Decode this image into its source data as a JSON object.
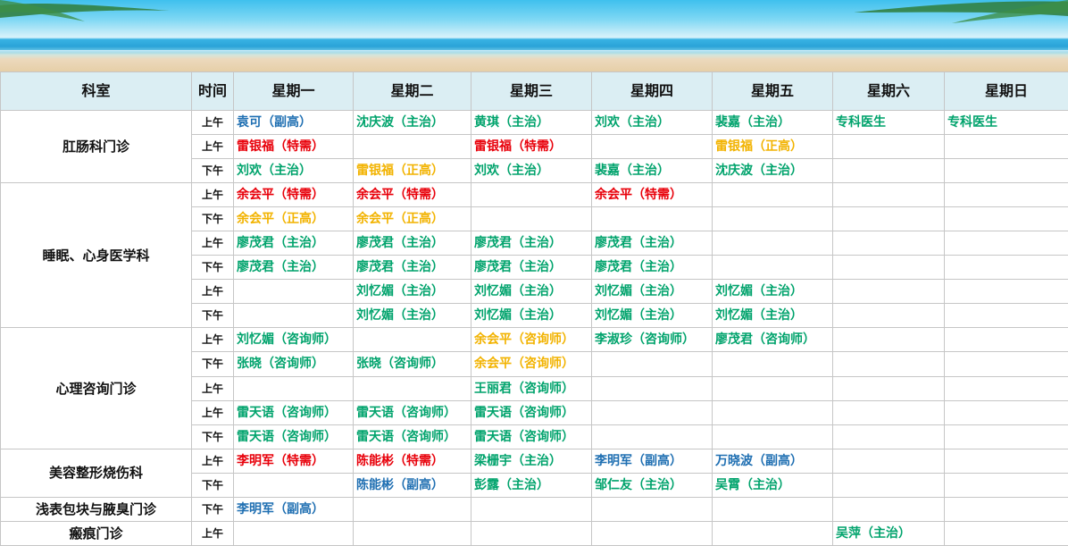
{
  "colors": {
    "header_bg": "#dbeef3",
    "blue": "#1f6fb2",
    "green": "#00a36c",
    "red": "#e8000a",
    "orange": "#f2b300"
  },
  "headers": [
    "科室",
    "时间",
    "星期一",
    "星期二",
    "星期三",
    "星期四",
    "星期五",
    "星期六",
    "星期日"
  ],
  "departments": [
    {
      "name": "肛肠科门诊",
      "rows": [
        {
          "time": "上午",
          "cells": [
            {
              "t": "袁可（副高）",
              "c": "blue"
            },
            {
              "t": "沈庆波（主治）",
              "c": "green"
            },
            {
              "t": "黄琪（主治）",
              "c": "green"
            },
            {
              "t": "刘欢（主治）",
              "c": "green"
            },
            {
              "t": "裴嘉（主治）",
              "c": "green"
            },
            {
              "t": "专科医生",
              "c": "green"
            },
            {
              "t": "专科医生",
              "c": "green"
            }
          ]
        },
        {
          "time": "上午",
          "cells": [
            {
              "t": "雷银福（特需）",
              "c": "red"
            },
            {
              "t": "",
              "c": ""
            },
            {
              "t": "雷银福（特需）",
              "c": "red"
            },
            {
              "t": "",
              "c": ""
            },
            {
              "t": "雷银福（正高）",
              "c": "orange"
            },
            {
              "t": "",
              "c": ""
            },
            {
              "t": "",
              "c": ""
            }
          ]
        },
        {
          "time": "下午",
          "cells": [
            {
              "t": "刘欢（主治）",
              "c": "green"
            },
            {
              "t": "雷银福（正高）",
              "c": "orange"
            },
            {
              "t": "刘欢（主治）",
              "c": "green"
            },
            {
              "t": "裴嘉（主治）",
              "c": "green"
            },
            {
              "t": "沈庆波（主治）",
              "c": "green"
            },
            {
              "t": "",
              "c": ""
            },
            {
              "t": "",
              "c": ""
            }
          ]
        }
      ]
    },
    {
      "name": "睡眠、心身医学科",
      "rows": [
        {
          "time": "上午",
          "cells": [
            {
              "t": "余会平（特需）",
              "c": "red"
            },
            {
              "t": "余会平（特需）",
              "c": "red"
            },
            {
              "t": "",
              "c": ""
            },
            {
              "t": "余会平（特需）",
              "c": "red"
            },
            {
              "t": "",
              "c": ""
            },
            {
              "t": "",
              "c": ""
            },
            {
              "t": "",
              "c": ""
            }
          ]
        },
        {
          "time": "下午",
          "cells": [
            {
              "t": "余会平（正高）",
              "c": "orange"
            },
            {
              "t": "余会平（正高）",
              "c": "orange"
            },
            {
              "t": "",
              "c": ""
            },
            {
              "t": "",
              "c": ""
            },
            {
              "t": "",
              "c": ""
            },
            {
              "t": "",
              "c": ""
            },
            {
              "t": "",
              "c": ""
            }
          ]
        },
        {
          "time": "上午",
          "cells": [
            {
              "t": "廖茂君（主治）",
              "c": "green"
            },
            {
              "t": "廖茂君（主治）",
              "c": "green"
            },
            {
              "t": "廖茂君（主治）",
              "c": "green"
            },
            {
              "t": "廖茂君（主治）",
              "c": "green"
            },
            {
              "t": "",
              "c": ""
            },
            {
              "t": "",
              "c": ""
            },
            {
              "t": "",
              "c": ""
            }
          ]
        },
        {
          "time": "下午",
          "cells": [
            {
              "t": "廖茂君（主治）",
              "c": "green"
            },
            {
              "t": "廖茂君（主治）",
              "c": "green"
            },
            {
              "t": "廖茂君（主治）",
              "c": "green"
            },
            {
              "t": "廖茂君（主治）",
              "c": "green"
            },
            {
              "t": "",
              "c": ""
            },
            {
              "t": "",
              "c": ""
            },
            {
              "t": "",
              "c": ""
            }
          ]
        },
        {
          "time": "上午",
          "cells": [
            {
              "t": "",
              "c": ""
            },
            {
              "t": "刘忆媚（主治）",
              "c": "green"
            },
            {
              "t": "刘忆媚（主治）",
              "c": "green"
            },
            {
              "t": "刘忆媚（主治）",
              "c": "green"
            },
            {
              "t": "刘忆媚（主治）",
              "c": "green"
            },
            {
              "t": "",
              "c": ""
            },
            {
              "t": "",
              "c": ""
            }
          ]
        },
        {
          "time": "下午",
          "cells": [
            {
              "t": "",
              "c": ""
            },
            {
              "t": "刘忆媚（主治）",
              "c": "green"
            },
            {
              "t": "刘忆媚（主治）",
              "c": "green"
            },
            {
              "t": "刘忆媚（主治）",
              "c": "green"
            },
            {
              "t": "刘忆媚（主治）",
              "c": "green"
            },
            {
              "t": "",
              "c": ""
            },
            {
              "t": "",
              "c": ""
            }
          ]
        }
      ]
    },
    {
      "name": "心理咨询门诊",
      "rows": [
        {
          "time": "上午",
          "cells": [
            {
              "t": "刘忆媚（咨询师）",
              "c": "green"
            },
            {
              "t": "",
              "c": ""
            },
            {
              "t": "余会平（咨询师）",
              "c": "orange"
            },
            {
              "t": "李淑珍（咨询师）",
              "c": "green"
            },
            {
              "t": "廖茂君（咨询师）",
              "c": "green"
            },
            {
              "t": "",
              "c": ""
            },
            {
              "t": "",
              "c": ""
            }
          ]
        },
        {
          "time": "下午",
          "cells": [
            {
              "t": "张晓（咨询师）",
              "c": "green"
            },
            {
              "t": "张晓（咨询师）",
              "c": "green"
            },
            {
              "t": "余会平（咨询师）",
              "c": "orange"
            },
            {
              "t": "",
              "c": ""
            },
            {
              "t": "",
              "c": ""
            },
            {
              "t": "",
              "c": ""
            },
            {
              "t": "",
              "c": ""
            }
          ]
        },
        {
          "time": "上午",
          "cells": [
            {
              "t": "",
              "c": ""
            },
            {
              "t": "",
              "c": ""
            },
            {
              "t": "王丽君（咨询师）",
              "c": "green"
            },
            {
              "t": "",
              "c": ""
            },
            {
              "t": "",
              "c": ""
            },
            {
              "t": "",
              "c": ""
            },
            {
              "t": "",
              "c": ""
            }
          ]
        },
        {
          "time": "上午",
          "cells": [
            {
              "t": "雷天语（咨询师）",
              "c": "green"
            },
            {
              "t": "雷天语（咨询师）",
              "c": "green"
            },
            {
              "t": "雷天语（咨询师）",
              "c": "green"
            },
            {
              "t": "",
              "c": ""
            },
            {
              "t": "",
              "c": ""
            },
            {
              "t": "",
              "c": ""
            },
            {
              "t": "",
              "c": ""
            }
          ]
        },
        {
          "time": "下午",
          "cells": [
            {
              "t": "雷天语（咨询师）",
              "c": "green"
            },
            {
              "t": "雷天语（咨询师）",
              "c": "green"
            },
            {
              "t": "雷天语（咨询师）",
              "c": "green"
            },
            {
              "t": "",
              "c": ""
            },
            {
              "t": "",
              "c": ""
            },
            {
              "t": "",
              "c": ""
            },
            {
              "t": "",
              "c": ""
            }
          ]
        }
      ]
    },
    {
      "name": "美容整形烧伤科",
      "rows": [
        {
          "time": "上午",
          "cells": [
            {
              "t": "李明军（特需）",
              "c": "red"
            },
            {
              "t": "陈能彬（特需）",
              "c": "red"
            },
            {
              "t": "梁栅宇（主治）",
              "c": "green"
            },
            {
              "t": "李明军（副高）",
              "c": "blue"
            },
            {
              "t": "万晓波（副高）",
              "c": "blue"
            },
            {
              "t": "",
              "c": ""
            },
            {
              "t": "",
              "c": ""
            }
          ]
        },
        {
          "time": "下午",
          "cells": [
            {
              "t": "",
              "c": ""
            },
            {
              "t": "陈能彬（副高）",
              "c": "blue"
            },
            {
              "t": "彭露（主治）",
              "c": "green"
            },
            {
              "t": "邹仁友（主治）",
              "c": "green"
            },
            {
              "t": "吴霄（主治）",
              "c": "green"
            },
            {
              "t": "",
              "c": ""
            },
            {
              "t": "",
              "c": ""
            }
          ]
        }
      ]
    },
    {
      "name": "浅表包块与腋臭门诊",
      "rows": [
        {
          "time": "下午",
          "cells": [
            {
              "t": "李明军（副高）",
              "c": "blue"
            },
            {
              "t": "",
              "c": ""
            },
            {
              "t": "",
              "c": ""
            },
            {
              "t": "",
              "c": ""
            },
            {
              "t": "",
              "c": ""
            },
            {
              "t": "",
              "c": ""
            },
            {
              "t": "",
              "c": ""
            }
          ]
        }
      ]
    },
    {
      "name": "瘢痕门诊",
      "rows": [
        {
          "time": "上午",
          "cells": [
            {
              "t": "",
              "c": ""
            },
            {
              "t": "",
              "c": ""
            },
            {
              "t": "",
              "c": ""
            },
            {
              "t": "",
              "c": ""
            },
            {
              "t": "",
              "c": ""
            },
            {
              "t": "吴萍（主治）",
              "c": "green"
            },
            {
              "t": "",
              "c": ""
            }
          ]
        }
      ]
    }
  ]
}
